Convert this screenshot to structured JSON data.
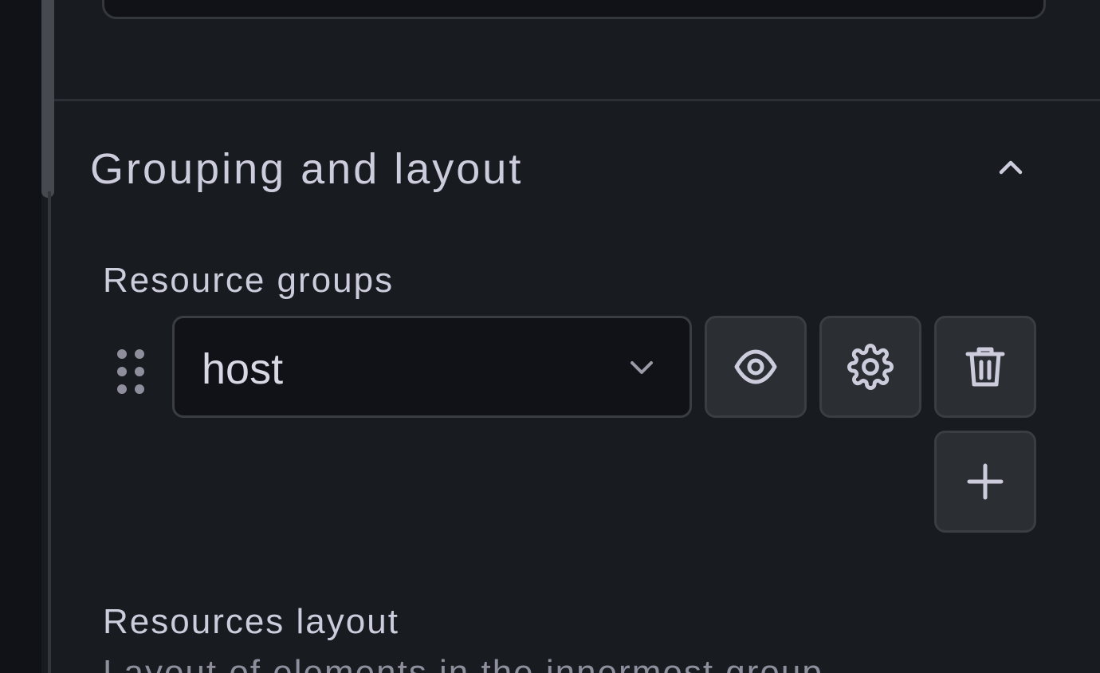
{
  "section": {
    "title": "Grouping and layout"
  },
  "resource_groups": {
    "label": "Resource groups",
    "items": [
      {
        "value": "host"
      }
    ]
  },
  "resources_layout": {
    "label": "Resources layout",
    "description": "Layout of elements in the innermost group"
  },
  "icons": {
    "collapse": "chevron-up-icon",
    "drag": "drag-handle-icon",
    "dropdown": "chevron-down-icon",
    "visibility": "eye-icon",
    "settings": "gear-icon",
    "delete": "trash-icon",
    "add": "plus-icon"
  },
  "colors": {
    "background": "#181b1f",
    "input_background": "#111217",
    "button_background": "#2b2e33",
    "border": "#3a3d43",
    "text": "#ccccdc",
    "muted_text": "#8e8e9c"
  }
}
